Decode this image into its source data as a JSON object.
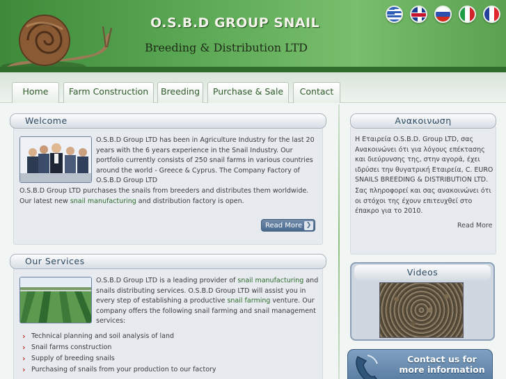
{
  "header": {
    "title": "O.S.B.D GROUP SNAIL",
    "subtitle": "Breeding & Distribution LTD",
    "flags": [
      "greek-flag-icon",
      "uk-flag-icon",
      "russian-flag-icon",
      "italian-flag-icon",
      "french-flag-icon"
    ]
  },
  "nav": {
    "tabs": [
      {
        "label": "Home"
      },
      {
        "label": "Farm Construction"
      },
      {
        "label": "Breeding"
      },
      {
        "label": "Purchase & Sale"
      },
      {
        "label": "Contact"
      }
    ]
  },
  "welcome": {
    "heading": "Welcome",
    "p1": "O.S.B.D Group LTD has been in Agriculture Industry for the last 20 years with the 6 years experience in the Snail Industry. Our portfolio currently consists of 250 snail farms in various countries around the world - Greece & Cyprus. The Company Factory of O.S.B.D Group LTD",
    "p2a": "O.S.B.D Group LTD purchases the snails from breeders and distributes them worldwide. Our latest new ",
    "p2link": "snail manufacturing",
    "p2b": " and distribution factory is open.",
    "read_more": "Read More"
  },
  "services": {
    "heading": "Our Services",
    "p1a": "O.S.B.D Group LTD is a leading provider of ",
    "p1link1": "snail manufacturing",
    "p1b": " and snails distributing services. O.S.B.D Group LTD will assist you in every step of establishing a productive ",
    "p1link2": "snail farming",
    "p1c": " venture. Our company offers the following snail farming and snail management services:",
    "bullets": [
      "Technical planning and soil analysis of land",
      "Snail farms construction",
      "Supply of breeding snails",
      "Purchasing of snails from your production to our factory"
    ]
  },
  "announcement": {
    "heading": "Ανακοινωση",
    "p1": "Η Εταιρεία O.S.B.D. Group LTD, σας Ανακοινώνει ότι για λόγους επέκτασης και διεύρυνσης της, στην αγορά, έχει ιδρύσει την θυγατρική Εταιρεία, C. EURO SNAILS BREEDING & DISTRIBUTION LTD.",
    "p2": "Σας πληροφορεί και σας ανακοινώνει ότι οι στόχοι της έχουν επιτευχθεί στο έπακρο για το 2010.",
    "read_more": "Read More"
  },
  "videos": {
    "heading": "Videos"
  },
  "contact": {
    "label": "Contact us for more information"
  },
  "colors": {
    "header_green": "#58a652",
    "panel_heading": "#2c4960",
    "link_green": "#2d6a2a",
    "bullet_red": "#c0392b"
  }
}
